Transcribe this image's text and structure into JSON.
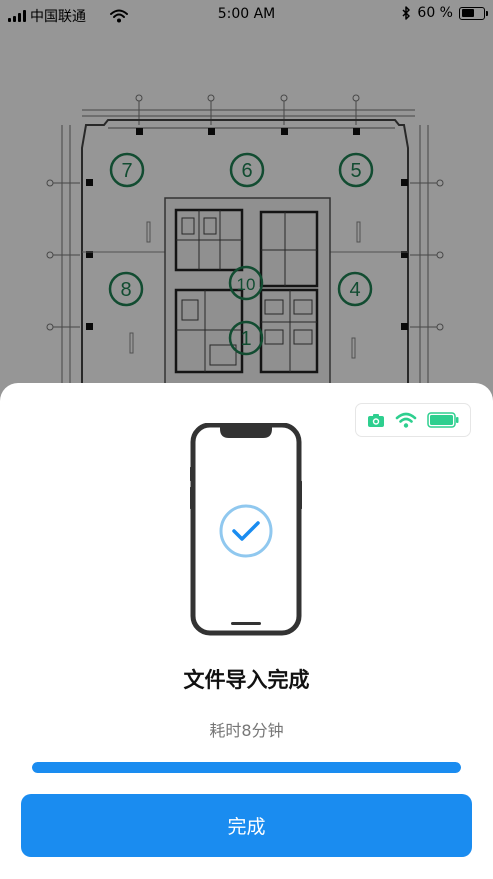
{
  "status_bar": {
    "carrier": "中国联通",
    "time": "5:00 AM",
    "battery_text": "60 %",
    "icons": [
      "signal-icon",
      "wifi-icon",
      "bluetooth-icon",
      "battery-icon"
    ]
  },
  "floor_plan": {
    "zones": [
      "7",
      "6",
      "5",
      "8",
      "10",
      "4",
      "1"
    ],
    "accent_color": "#1e7f52"
  },
  "sheet": {
    "device_icons": [
      "camera-icon",
      "wifi-icon",
      "battery-icon"
    ],
    "device_icon_color": "#2ecf8f",
    "check_icon": "check-icon",
    "title": "文件导入完成",
    "elapsed": "耗时8分钟",
    "progress": 1.0,
    "done_label": "完成",
    "accent_color": "#1a8cf0"
  }
}
